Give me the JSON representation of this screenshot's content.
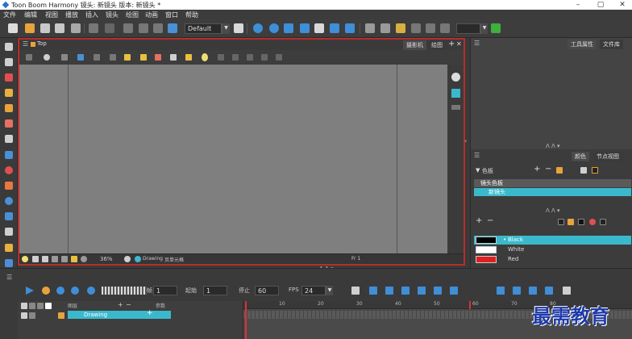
{
  "window": {
    "title": "Toon Boom Harmony 镜头: 新镜头 版本: 新镜头 *",
    "controls": [
      "–",
      "▢",
      "✕"
    ]
  },
  "menu": [
    "文件",
    "编辑",
    "视图",
    "播放",
    "插入",
    "镜头",
    "绘图",
    "动画",
    "窗口",
    "帮助"
  ],
  "toolbar": {
    "workspace_value": "Default",
    "colors": {
      "accent": "#3bb9cc",
      "frame": "#b82d2d"
    }
  },
  "view_panel": {
    "title": "Top",
    "tabs": [
      "摄影机",
      "绘图"
    ],
    "add_label": "+",
    "close_label": "✕",
    "status": {
      "zoom": "36%",
      "drawing_label": "Drawing",
      "mode_label": "页单元格",
      "frame": "Fr 1"
    }
  },
  "right_top": {
    "tabs": [
      "工具属性",
      "文件库"
    ]
  },
  "colour_panel": {
    "tabs": [
      "颜色",
      "节点视图"
    ],
    "palette_header": "色板",
    "palette_list_title": "镜头色板",
    "palette_selected": "新镜头",
    "swatches": [
      {
        "name": "Black",
        "color": "#000000",
        "selected": true
      },
      {
        "name": "White",
        "color": "#ffffff",
        "selected": false
      },
      {
        "name": "Red",
        "color": "#e02020",
        "selected": false
      }
    ]
  },
  "timeline": {
    "current_frame": "1",
    "start_label": "起始",
    "start_value": "1",
    "stop_label": "停止",
    "stop_value": "60",
    "fps_label": "FPS",
    "fps_value": "24",
    "layer_header": "图层",
    "params_header": "参数",
    "layer_name": "Drawing",
    "ruler_ticks": [
      "10",
      "20",
      "30",
      "40",
      "50",
      "60",
      "70",
      "80"
    ]
  },
  "watermark": "最需教育"
}
